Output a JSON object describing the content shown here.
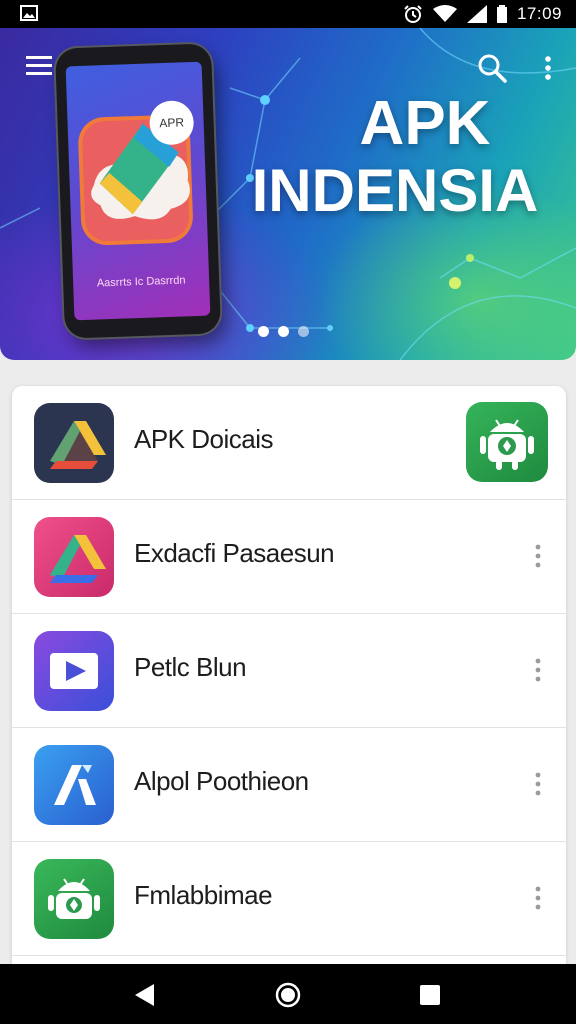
{
  "status_bar": {
    "time": "17:09",
    "icons": [
      "gallery-icon",
      "alarm-icon",
      "wifi-icon",
      "signal-icon",
      "battery-icon"
    ]
  },
  "banner": {
    "title_line1": "APK",
    "title_line2": "INDENSIA",
    "phone_caption": "Aasrrts Ic Dasrrdn",
    "phone_badge": "APR",
    "carousel_dots": 3,
    "active_dot": 1
  },
  "toolbar": {
    "icons": [
      "menu-icon",
      "search-icon",
      "more-vert-icon"
    ]
  },
  "apps": [
    {
      "name": "APK Doicais",
      "icon": "drive-triangle-icon",
      "icon_bg": "#2b3550",
      "trailing": "android-badge-icon"
    },
    {
      "name": "Exdacfi Pasaesun",
      "icon": "drive-triangle-icon",
      "icon_bg": "#e23a7a",
      "trailing": "more-vert-icon"
    },
    {
      "name": "Petlc Blun",
      "icon": "play-icon",
      "icon_bg": "#6a3fd0",
      "trailing": "more-vert-icon"
    },
    {
      "name": "Alpol Poothieon",
      "icon": "a-logo-icon",
      "icon_bg": "#2f7de0",
      "trailing": "more-vert-icon"
    },
    {
      "name": "Fmlabbimae",
      "icon": "android-icon",
      "icon_bg": "#2fa64f",
      "trailing": "more-vert-icon"
    }
  ],
  "nav_bar": {
    "icons": [
      "back-icon",
      "home-icon",
      "recents-icon"
    ]
  },
  "colors": {
    "accent_green": "#2fa64f",
    "banner_start": "#3a2aa0",
    "banner_end": "#3ec78c"
  }
}
